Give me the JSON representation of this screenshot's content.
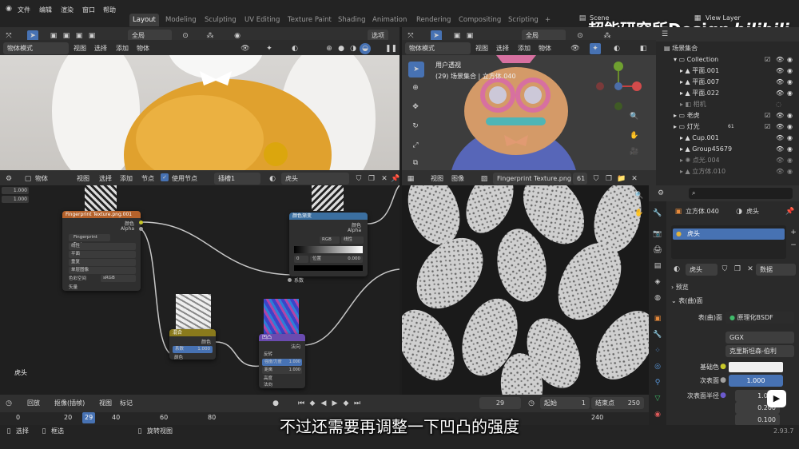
{
  "topbar": {
    "menus": [
      "文件",
      "编辑",
      "渲染",
      "窗口",
      "帮助"
    ],
    "tabs": [
      "Layout",
      "Modeling",
      "Sculpting",
      "UV Editing",
      "Texture Paint",
      "Shading",
      "Animation",
      "Rendering",
      "Compositing",
      "Scripting"
    ],
    "active_tab": "Layout",
    "add_tab": "+",
    "scene_label": "Scene",
    "view_layer_label": "View Layer",
    "watermark": "超能研究所Design",
    "logo": "bilibili"
  },
  "viewport_left": {
    "header": {
      "global": "全局",
      "options": "选项"
    },
    "mode": "物体模式",
    "menus": [
      "视图",
      "选择",
      "添加",
      "物体"
    ]
  },
  "viewport_right": {
    "header": {
      "global": "全局",
      "options": "选项"
    },
    "mode": "物体模式",
    "menus": [
      "视图",
      "选择",
      "添加",
      "物体"
    ],
    "overlay_title": "用户透视",
    "overlay_sub": "(29) 场景集合 | 立方体.040"
  },
  "node_editor": {
    "type": "物体",
    "menus": [
      "视图",
      "选择",
      "添加",
      "节点"
    ],
    "use_nodes": "使用节点",
    "slot": "插槽1",
    "material": "虎头",
    "values": [
      "1.000",
      "1.000"
    ],
    "object_name": "虎头",
    "nodes": {
      "image": {
        "title": "Fingerprint Texture.png.001",
        "out_color": "颜色",
        "out_alpha": "Alpha",
        "file": "Fingerprint Text...",
        "rows": [
          "线性",
          "平面",
          "重复",
          "单层图像"
        ],
        "colorspace_label": "色彩空间",
        "colorspace": "sRGB",
        "in_vector": "矢量"
      },
      "ramp": {
        "title": "颜色渐变",
        "out_color": "颜色",
        "out_alpha": "Alpha",
        "mode": "RGB",
        "interp": "线性",
        "pos_label": "0",
        "pos_text": "位置",
        "pos_value": "0.000",
        "in_fac": "系数"
      },
      "mix": {
        "title": "混合",
        "out_color": "颜色",
        "fac_label": "系数",
        "fac_value": "1.000",
        "in_color": "颜色"
      },
      "bump": {
        "title": "凹凸",
        "out_normal": "法向",
        "invert": "反转",
        "strength_label": "强度/力度",
        "strength_value": "1.000",
        "distance_label": "距离",
        "distance_value": "1.000",
        "height": "高度",
        "normal": "法向"
      }
    }
  },
  "image_editor": {
    "menus": [
      "视图",
      "图像"
    ],
    "image_name": "Fingerprint Texture.png",
    "users": "61"
  },
  "outliner": {
    "title": "场景集合",
    "rows": [
      {
        "label": "Collection"
      },
      {
        "label": "平面.001"
      },
      {
        "label": "平面.007"
      },
      {
        "label": "平面.022"
      },
      {
        "label": "相机"
      },
      {
        "label": "老虎"
      },
      {
        "label": "灯光"
      },
      {
        "label": "Cup.001"
      },
      {
        "label": "Group45679"
      },
      {
        "label": "点光.004"
      },
      {
        "label": "立方体.010"
      }
    ],
    "light_count": "61"
  },
  "properties": {
    "object": "立方体.040",
    "material": "虎头",
    "slot_material": "虎头",
    "data_label": "数据",
    "preview": "预览",
    "surface_section": "表(曲)面",
    "surface_label": "表(曲)面",
    "surface_value": "原理化BSDF",
    "distribution": "GGX",
    "subsurface_method": "克里斯坦森-伯利",
    "base_color_label": "基础色",
    "subsurface_label": "次表面",
    "subsurface_value": "1.000",
    "radius_label": "次表面半径",
    "radius_values": [
      "1.000",
      "0.200",
      "0.100"
    ],
    "version": "2.93.7"
  },
  "timeline": {
    "menus": [
      "回放",
      "抠像(插帧)",
      "视图",
      "标记"
    ],
    "current_frame": "29",
    "start_label": "起始",
    "start": "1",
    "end_label": "结束点",
    "end": "250",
    "ticks": [
      "0",
      "20",
      "29",
      "40",
      "60",
      "80",
      "240"
    ]
  },
  "statusbar": {
    "select": "选择",
    "box": "框选",
    "rotate": "旋转视图"
  },
  "subtitle": "不过还需要再调整一下凹凸的强度",
  "colors": {
    "accent": "#4772b3",
    "bg": "#1d1d1d",
    "header": "#303030"
  }
}
